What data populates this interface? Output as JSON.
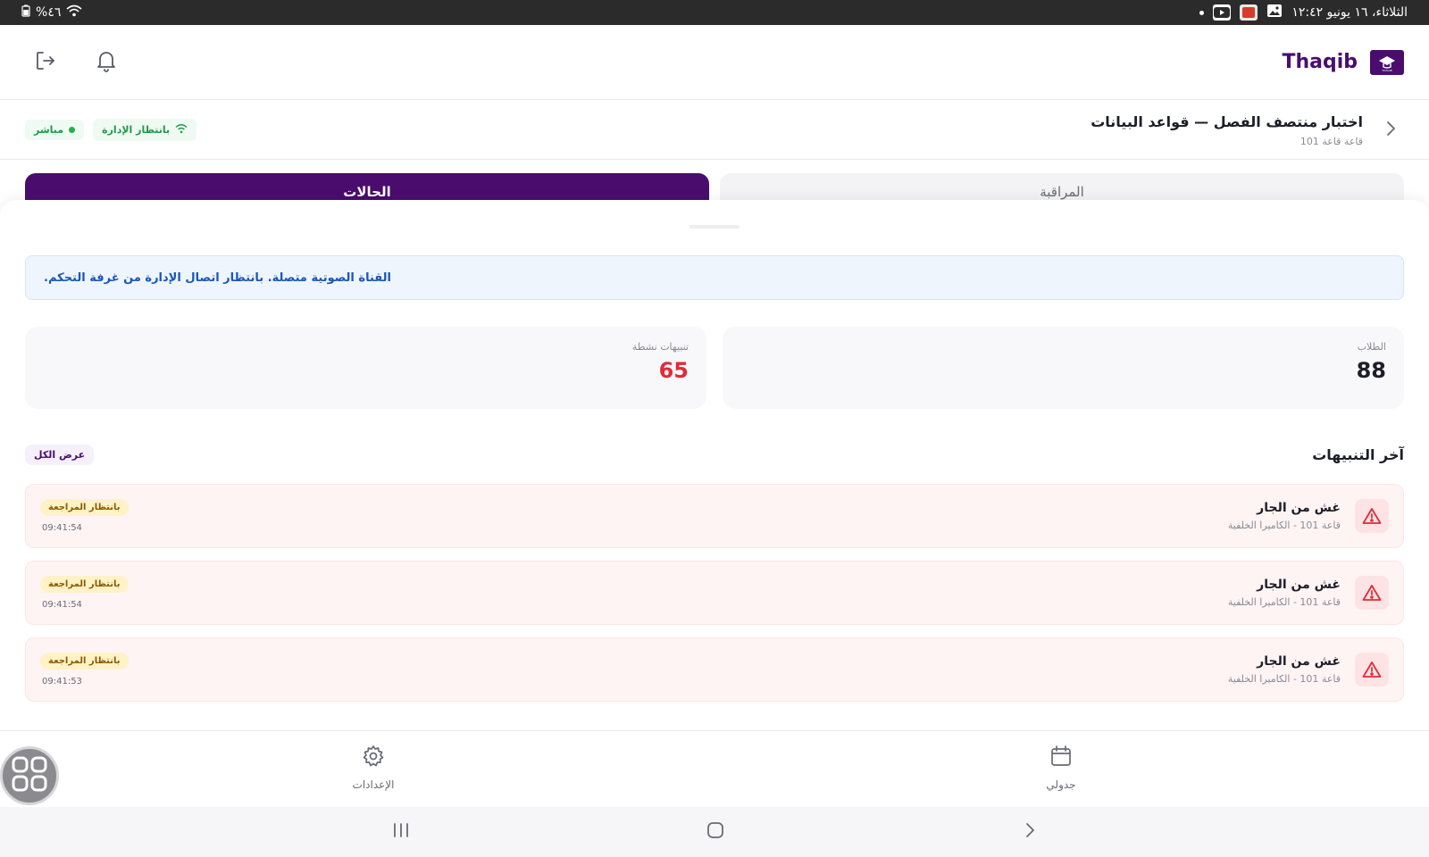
{
  "status_bar": {
    "datetime": "الثلاثاء، ١٦ يونيو  ١٢:٤٢",
    "battery": "%٤٦"
  },
  "header": {
    "brand": "Thaqib",
    "logo_caption": "THAQIB"
  },
  "exam": {
    "title": "اختبار منتصف الفصل — قواعد البيانات",
    "room": "قاعة قاعة 101",
    "badge_admin": "بانتظار الإدارة",
    "badge_live": "مباشر"
  },
  "tabs": {
    "monitoring": "المراقبة",
    "cases": "الحالات"
  },
  "info_banner": "القناة الصوتية متصلة. بانتظار اتصال الإدارة من غرفة التحكم.",
  "stats": {
    "students_label": "الطلاب",
    "students_value": "88",
    "alerts_label": "تنبيهات نشطة",
    "alerts_value": "65"
  },
  "recent": {
    "title": "آخر التنبيهات",
    "view_all": "عرض الكل",
    "items": [
      {
        "title": "غش من الجار",
        "subtitle": "قاعة 101 - الكاميرا الخلفية",
        "status": "بانتظار المراجعة",
        "time": "09:41:54"
      },
      {
        "title": "غش من الجار",
        "subtitle": "قاعة 101 - الكاميرا الخلفية",
        "status": "بانتظار المراجعة",
        "time": "09:41:54"
      },
      {
        "title": "غش من الجار",
        "subtitle": "قاعة 101 - الكاميرا الخلفية",
        "status": "بانتظار المراجعة",
        "time": "09:41:53"
      }
    ]
  },
  "bottom_nav": {
    "schedule": "جدولي",
    "settings": "الإعدادات"
  },
  "colors": {
    "brand": "#4a0d6e",
    "alert_red": "#e02b3a",
    "live_green": "#22b14c",
    "info_blue": "#1a56b8"
  }
}
